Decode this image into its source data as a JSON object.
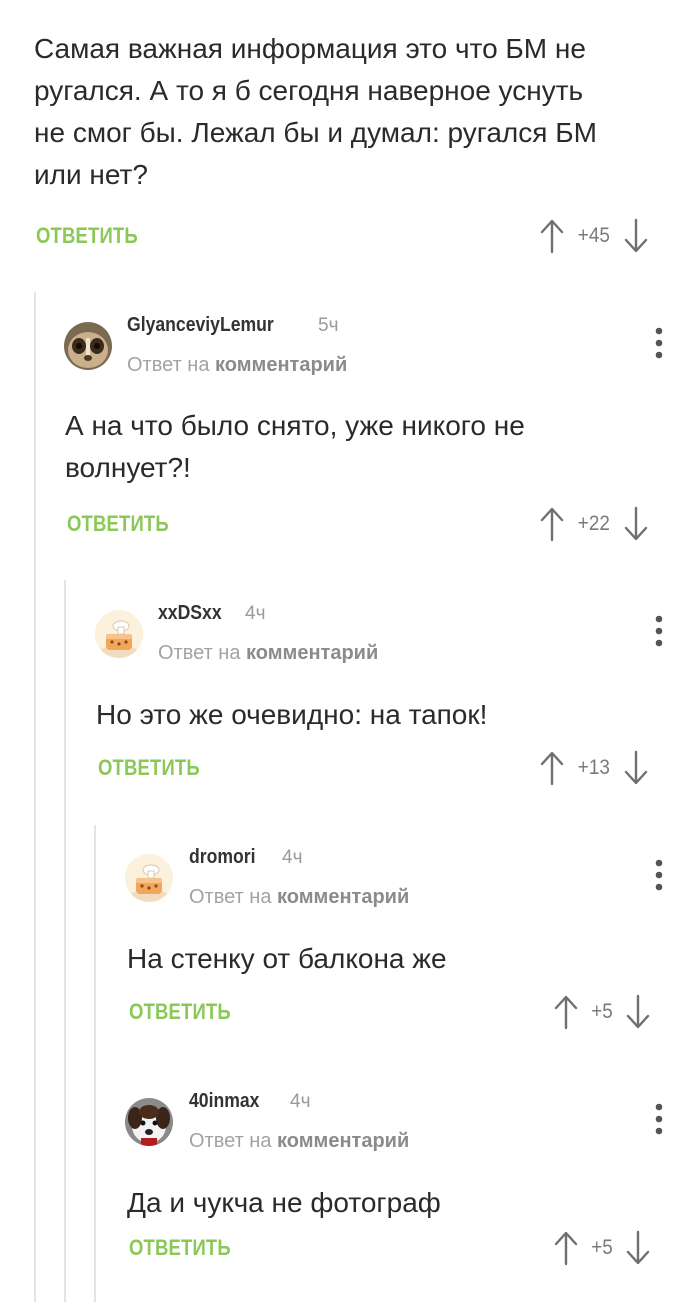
{
  "root_comment": {
    "text_lines": [
      "Самая важная информация это что БМ не",
      "ругался. А то я б сегодня наверное уснуть",
      "не смог бы. Лежал бы и думал: ругался БМ",
      "или нет?"
    ],
    "reply_label": "ОТВЕТИТЬ",
    "score": "+45"
  },
  "comments": [
    {
      "username": "GlyanceviyLemur",
      "time": "5ч",
      "meta_prefix": "Ответ на",
      "meta_link": "комментарий",
      "text_lines": [
        "А на что было снято, уже никого не",
        "волнует?!"
      ],
      "reply_label": "ОТВЕТИТЬ",
      "score": "+22"
    },
    {
      "username": "xxDSxx",
      "time": "4ч",
      "meta_prefix": "Ответ на",
      "meta_link": "комментарий",
      "text_lines": [
        "Но это же очевидно: на тапок!"
      ],
      "reply_label": "ОТВЕТИТЬ",
      "score": "+13"
    },
    {
      "username": "dromori",
      "time": "4ч",
      "meta_prefix": "Ответ на",
      "meta_link": "комментарий",
      "text_lines": [
        "На стенку от балкона же"
      ],
      "reply_label": "ОТВЕТИТЬ",
      "score": "+5"
    },
    {
      "username": "40inmax",
      "time": "4ч",
      "meta_prefix": "Ответ на",
      "meta_link": "комментарий",
      "text_lines": [
        "Да и чукча не фотограф"
      ],
      "reply_label": "ОТВЕТИТЬ",
      "score": "+5"
    }
  ],
  "colors": {
    "reply_green": "#8ac858",
    "thread_line": "#e4e4e4",
    "meta_gray": "#a3a3a3",
    "text": "#2a2a2a"
  }
}
